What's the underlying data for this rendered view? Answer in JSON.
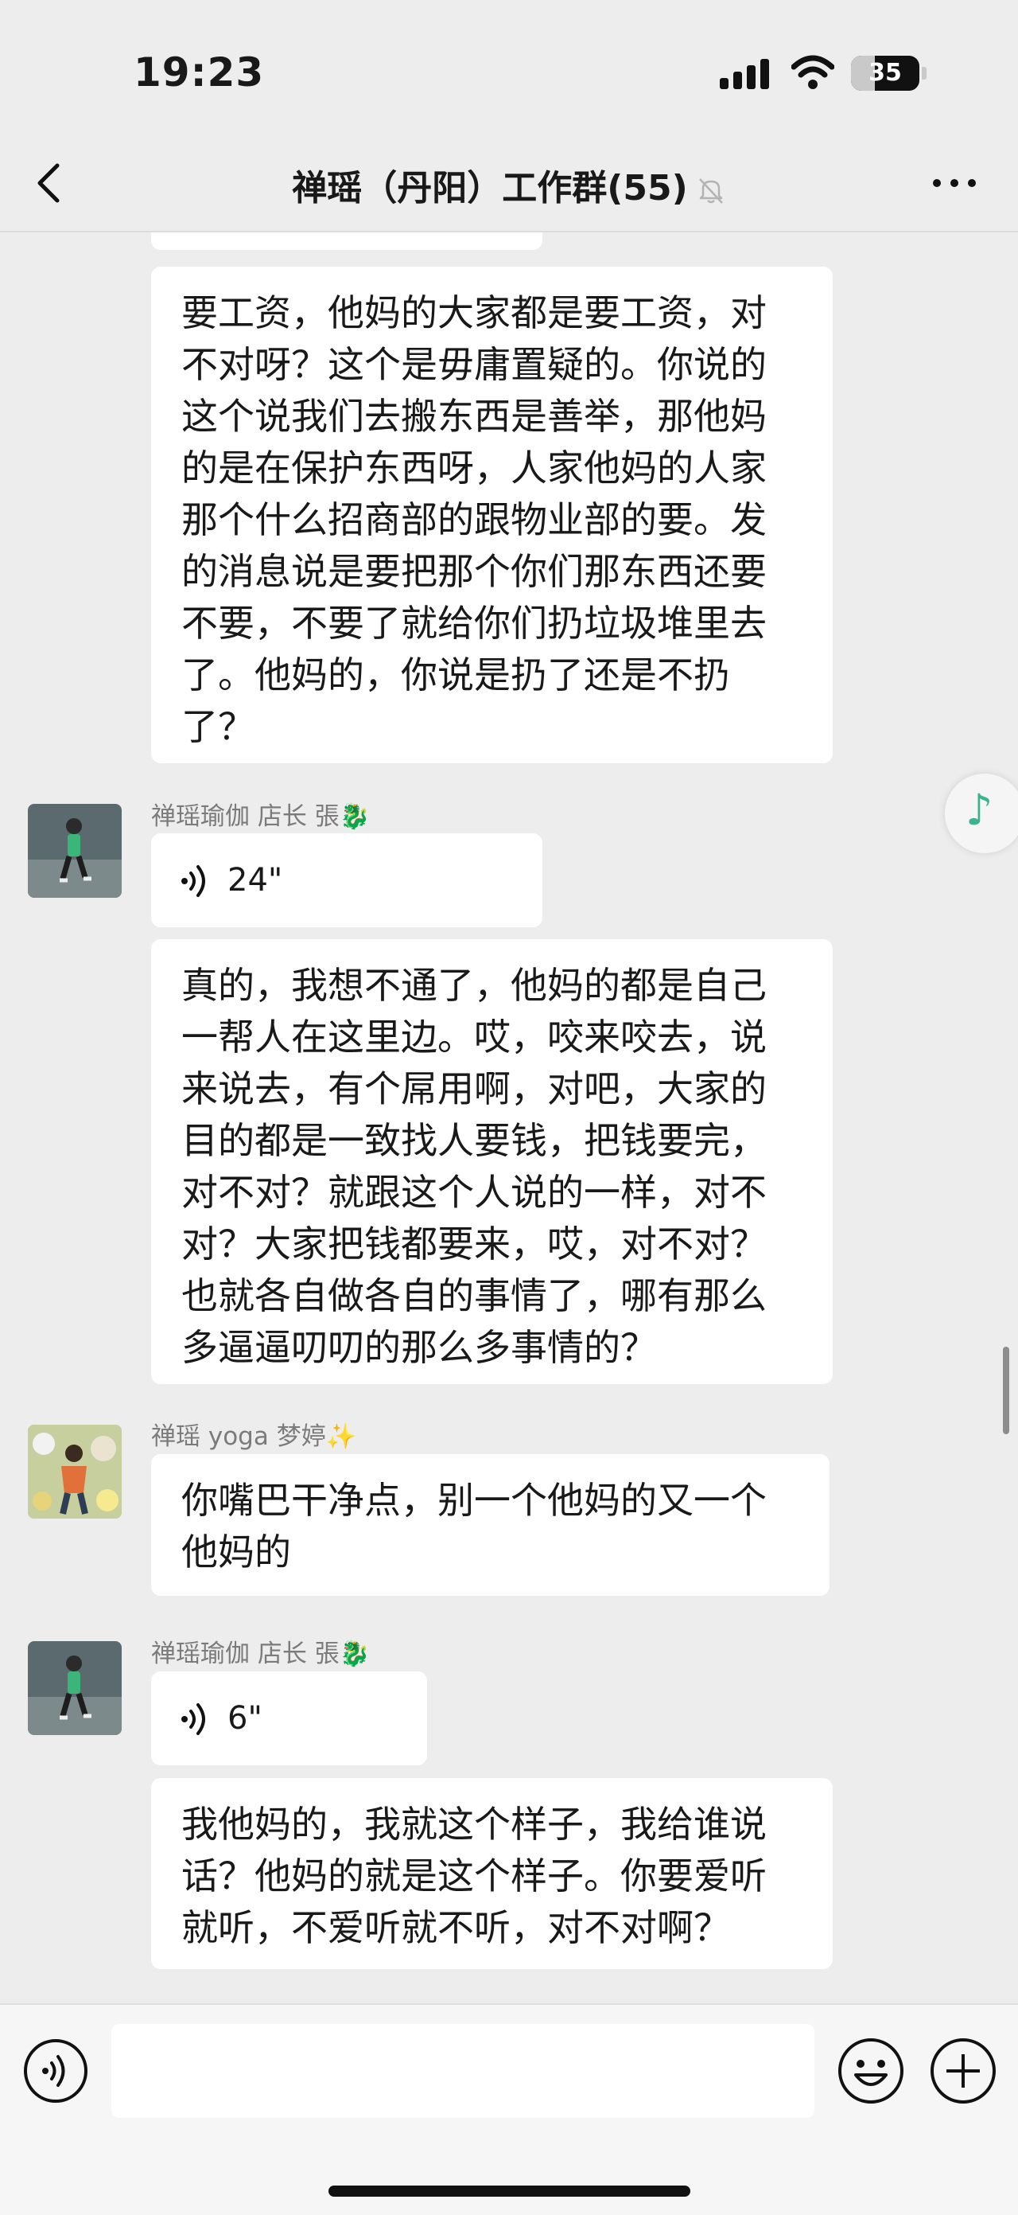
{
  "status_bar": {
    "time": "19:23",
    "battery": "35",
    "battery_fraction": 0.35
  },
  "header": {
    "title": "禅瑶（丹阳）工作群(55)"
  },
  "messages": [
    {
      "type": "text",
      "text": "要工资，他妈的大家都是要工资，对\n不对呀？这个是毋庸置疑的。你说的\n这个说我们去搬东西是善举，那他妈\n的是在保护东西呀，人家他妈的人家\n那个什么招商部的跟物业部的要。发\n的消息说是要把那个你们那东西还要\n不要，不要了就给你们扔垃圾堆里去\n了。他妈的，你说是扔了还是不扔\n了？"
    },
    {
      "type": "sender",
      "sender": "禅瑶瑜伽  店长 張🐉"
    },
    {
      "type": "voice",
      "duration": "24\""
    },
    {
      "type": "text",
      "text": "真的，我想不通了，他妈的都是自己\n一帮人在这里边。哎，咬来咬去，说\n来说去，有个屌用啊，对吧，大家的\n目的都是一致找人要钱，把钱要完，\n对不对？就跟这个人说的一样，对不\n对？大家把钱都要来，哎，对不对？\n也就各自做各自的事情了，哪有那么\n多逼逼叨叨的那么多事情的？"
    },
    {
      "type": "sender",
      "sender": "禅瑶 yoga 梦婷✨"
    },
    {
      "type": "text",
      "text": "你嘴巴干净点，别一个他妈的又一个\n他妈的"
    },
    {
      "type": "sender",
      "sender": "禅瑶瑜伽  店长 張🐉"
    },
    {
      "type": "voice",
      "duration": "6\""
    },
    {
      "type": "text",
      "text": "我他妈的，我就这个样子，我给谁说\n话？他妈的就是这个样子。你要爱听\n就听，不爱听就不听，对不对啊？"
    }
  ],
  "input": {
    "placeholder": ""
  },
  "colors": {
    "background": "#ededed",
    "bubble": "#ffffff",
    "sender_text": "#7b7b7b",
    "accent": "#3ab48f"
  },
  "icons": [
    "back-chevron-icon",
    "mute-bell-icon",
    "more-dots-icon",
    "music-note-icon",
    "voice-wave-icon",
    "emoji-icon",
    "plus-icon"
  ]
}
